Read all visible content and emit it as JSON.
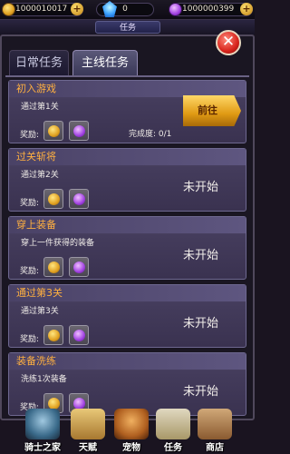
{
  "resources": {
    "gold": "1000010017",
    "gems": "0",
    "diamonds": "1000000399"
  },
  "title": "任务",
  "tabs": [
    {
      "label": "日常任务",
      "selected": false
    },
    {
      "label": "主线任务",
      "selected": true
    }
  ],
  "reward_label": "奖励:",
  "quests": [
    {
      "name": "初入游戏",
      "desc": "通过第1关",
      "status": "",
      "progress": "完成度: 0/1",
      "action": "前往"
    },
    {
      "name": "过关斩将",
      "desc": "通过第2关",
      "status": "未开始"
    },
    {
      "name": "穿上装备",
      "desc": "穿上一件获得的装备",
      "status": "未开始"
    },
    {
      "name": "通过第3关",
      "desc": "通过第3关",
      "status": "未开始"
    },
    {
      "name": "装备洗练",
      "desc": "洗练1次装备",
      "status": "未开始"
    }
  ],
  "nav": [
    {
      "label": "骑士之家",
      "icon": "knight-home-icon"
    },
    {
      "label": "天赋",
      "icon": "talent-book-icon"
    },
    {
      "label": "宠物",
      "icon": "pet-icon"
    },
    {
      "label": "任务",
      "icon": "quest-scroll-icon"
    },
    {
      "label": "商店",
      "icon": "shop-icon"
    }
  ]
}
